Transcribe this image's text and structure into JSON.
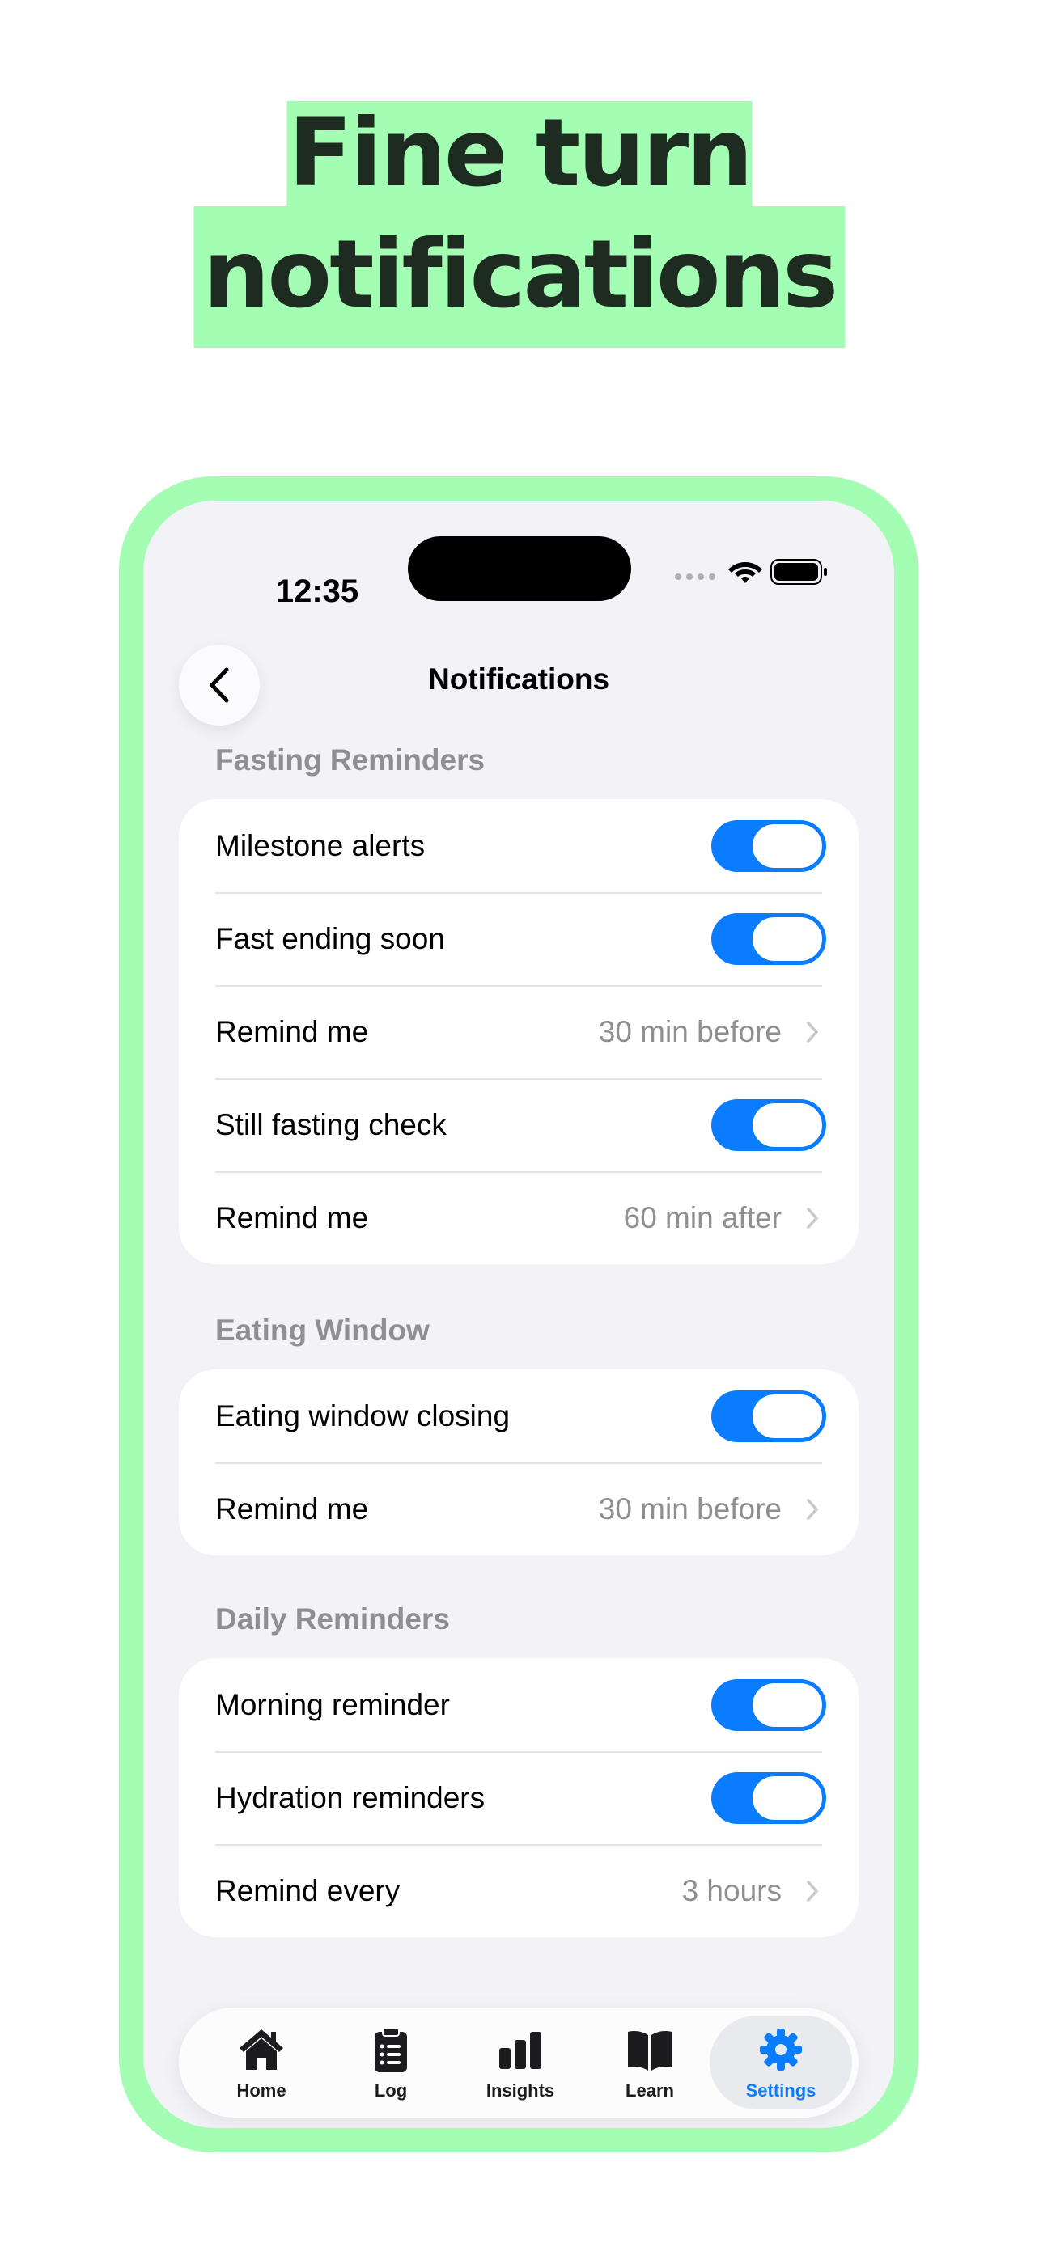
{
  "headline": {
    "line1": "Fine turn",
    "line2": "notifications"
  },
  "status_bar": {
    "time": "12:35"
  },
  "nav": {
    "title": "Notifications"
  },
  "sections": [
    {
      "title": "Fasting Reminders",
      "rows": [
        {
          "label": "Milestone alerts",
          "toggle_on": true
        },
        {
          "label": "Fast ending soon",
          "toggle_on": true
        },
        {
          "label": "Remind me",
          "value": "30 min before"
        },
        {
          "label": "Still fasting check",
          "toggle_on": true
        },
        {
          "label": "Remind me",
          "value": "60 min after"
        }
      ]
    },
    {
      "title": "Eating Window",
      "rows": [
        {
          "label": "Eating window closing",
          "toggle_on": true
        },
        {
          "label": "Remind me",
          "value": "30 min before"
        }
      ]
    },
    {
      "title": "Daily Reminders",
      "rows": [
        {
          "label": "Morning reminder",
          "toggle_on": true
        },
        {
          "label": "Hydration reminders",
          "toggle_on": true
        },
        {
          "label": "Remind every",
          "value": "3 hours"
        }
      ]
    }
  ],
  "tab_bar": {
    "tabs": [
      {
        "label": "Home",
        "icon": "home-icon",
        "active": false
      },
      {
        "label": "Log",
        "icon": "clipboard-icon",
        "active": false
      },
      {
        "label": "Insights",
        "icon": "bar-chart-icon",
        "active": false
      },
      {
        "label": "Learn",
        "icon": "book-icon",
        "active": false
      },
      {
        "label": "Settings",
        "icon": "gear-icon",
        "active": true
      }
    ]
  },
  "colors": {
    "accent": "#0a7cff",
    "highlight_green": "#a3fdb2",
    "screen_bg": "#f2f2f7",
    "secondary_text": "#8e8e93"
  }
}
